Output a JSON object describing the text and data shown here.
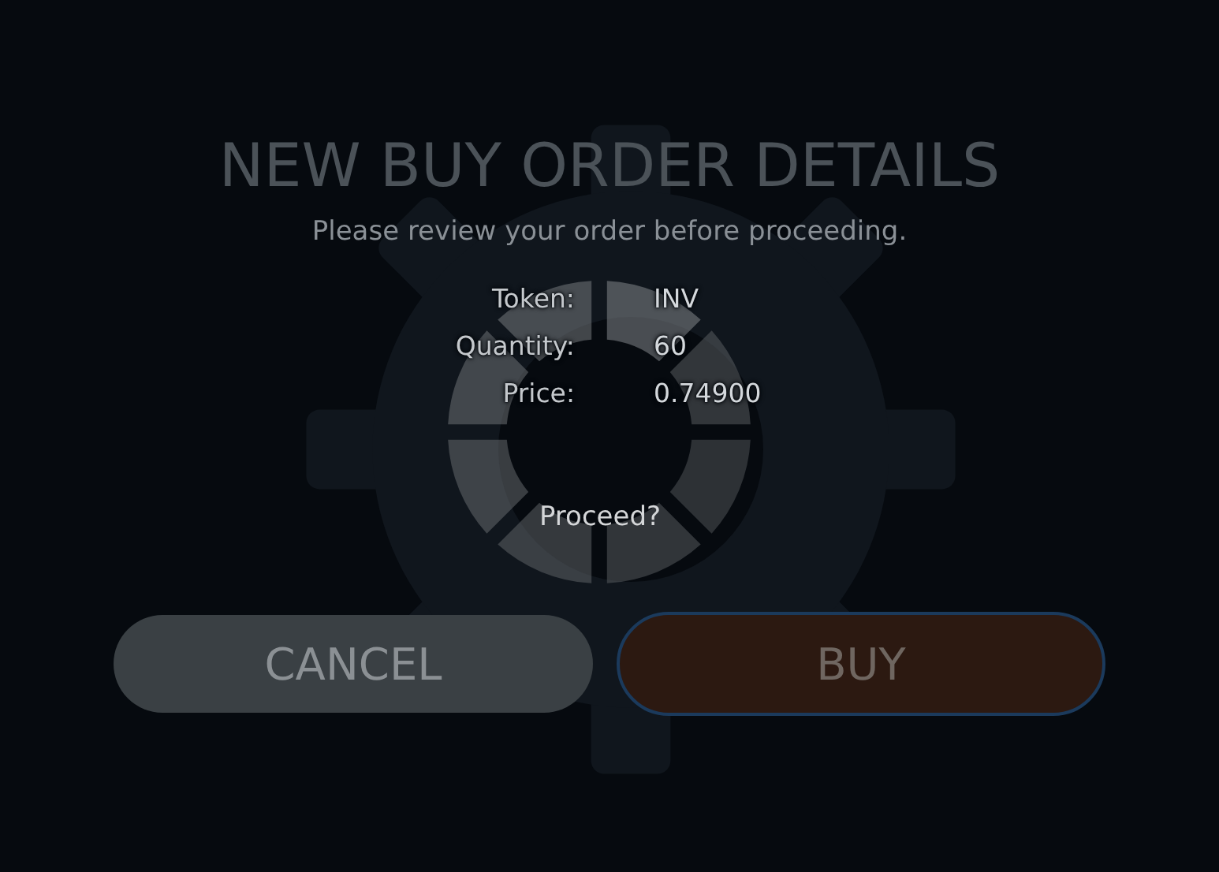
{
  "title": "NEW BUY ORDER DETAILS",
  "subtitle": "Please review your order before proceeding.",
  "details": [
    {
      "label": "Token:",
      "value": "INV"
    },
    {
      "label": "Quantity:",
      "value": "60"
    },
    {
      "label": "Price:",
      "value": "0.74900"
    }
  ],
  "prompt": "Proceed?",
  "buttons": [
    {
      "label": "CANCEL",
      "kind": "cancel"
    },
    {
      "label": "BUY",
      "kind": "buy"
    }
  ]
}
